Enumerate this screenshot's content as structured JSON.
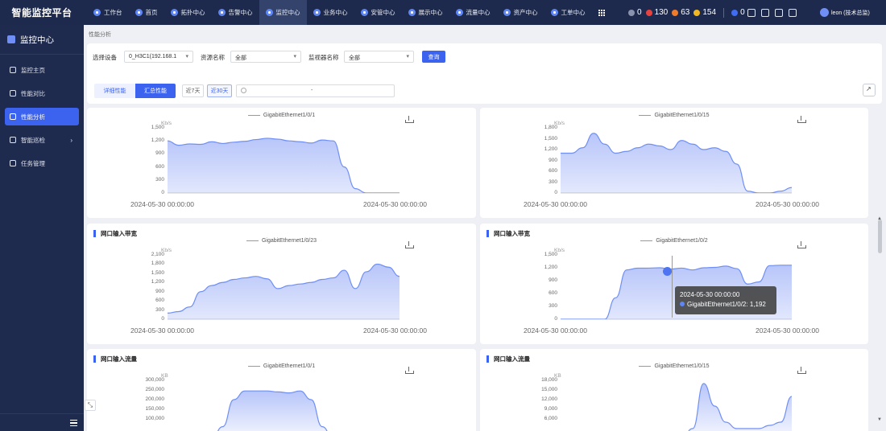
{
  "app": {
    "title": "智能监控平台"
  },
  "nav": [
    {
      "label": "工作台"
    },
    {
      "label": "首页"
    },
    {
      "label": "拓扑中心"
    },
    {
      "label": "告警中心"
    },
    {
      "label": "监控中心"
    },
    {
      "label": "业务中心"
    },
    {
      "label": "安管中心"
    },
    {
      "label": "展示中心"
    },
    {
      "label": "流量中心"
    },
    {
      "label": "资产中心"
    },
    {
      "label": "工单中心"
    }
  ],
  "alarms": [
    {
      "value": "0",
      "color": "#8a93ad"
    },
    {
      "value": "130",
      "color": "#e8423f"
    },
    {
      "value": "63",
      "color": "#f07c2a"
    },
    {
      "value": "154",
      "color": "#f2b823"
    },
    {
      "value": "0",
      "color": "#3f6cf1"
    }
  ],
  "user": {
    "name": "leon (技术总监)"
  },
  "sidebar": {
    "title": "监控中心",
    "items": [
      {
        "label": "监控主页"
      },
      {
        "label": "性能对比"
      },
      {
        "label": "性能分析"
      },
      {
        "label": "智能巡检"
      },
      {
        "label": "任务管理"
      }
    ]
  },
  "breadcrumb": "性能分析",
  "filter": {
    "device_label": "选择设备",
    "device_value": "0_H3C1(192.168.1",
    "resource_label": "资源名称",
    "resource_value": "全部",
    "monitor_label": "监视器名称",
    "monitor_value": "全部",
    "query": "查询",
    "tab_detail": "详细性能",
    "tab_summary": "汇总性能",
    "range7": "近7天",
    "range30": "近30天",
    "date_sep": "-"
  },
  "panels": [
    {
      "title": "",
      "legend": "GigabitEthernet1/0/1",
      "unit": "Kb/s",
      "yticks": [
        "1,500",
        "1,200",
        "900",
        "600",
        "300",
        "0"
      ],
      "xticks": [
        "2024-05-30 00:00:00",
        "2024-05-30 00:00:00"
      ]
    },
    {
      "title": "",
      "legend": "GigabitEthernet1/0/15",
      "unit": "Kb/s",
      "yticks": [
        "1,800",
        "1,500",
        "1,200",
        "900",
        "600",
        "300",
        "0"
      ],
      "xticks": [
        "2024-05-30 00:00:00",
        "2024-05-30 00:00:00"
      ]
    },
    {
      "title": "网口输入带宽",
      "legend": "GigabitEthernet1/0/23",
      "unit": "Kb/s",
      "yticks": [
        "2,100",
        "1,800",
        "1,500",
        "1,200",
        "900",
        "600",
        "300",
        "0"
      ],
      "xticks": [
        "2024-05-30 00:00:00",
        "2024-05-30 00:00:00"
      ]
    },
    {
      "title": "网口输入带宽",
      "legend": "GigabitEthernet1/0/2",
      "unit": "Kb/s",
      "yticks": [
        "1,500",
        "1,200",
        "900",
        "600",
        "300",
        "0"
      ],
      "xticks": [
        "2024-05-30 00:00:00",
        "2024-05-30 00:00:00"
      ]
    },
    {
      "title": "网口输入流量",
      "legend": "GigabitEthernet1/0/1",
      "unit": "KB",
      "yticks": [
        "300,000",
        "250,000",
        "200,000",
        "150,000",
        "100,000"
      ],
      "xticks": []
    },
    {
      "title": "网口输入流量",
      "legend": "GigabitEthernet1/0/15",
      "unit": "KB",
      "yticks": [
        "18,000",
        "15,000",
        "12,000",
        "9,000",
        "6,000"
      ],
      "xticks": []
    }
  ],
  "tooltip": {
    "time": "2024-05-30 00:00:00",
    "series": "GigabitEthernet1/0/2: 1,192"
  },
  "chart_data": [
    {
      "type": "area",
      "series": [
        {
          "name": "GigabitEthernet1/0/1",
          "values": [
            1200,
            1100,
            1130,
            1120,
            1180,
            1140,
            1170,
            1190,
            1230,
            1260,
            1240,
            1200,
            1180,
            1150,
            1220,
            1200,
            600,
            100,
            0,
            0,
            0,
            0
          ]
        }
      ],
      "ylabel": "Kb/s",
      "ylim": [
        0,
        1500
      ]
    },
    {
      "type": "area",
      "series": [
        {
          "name": "GigabitEthernet1/0/15",
          "values": [
            1100,
            1100,
            1250,
            1650,
            1350,
            1100,
            1150,
            1250,
            1350,
            1300,
            1200,
            1450,
            1350,
            1200,
            1250,
            1150,
            800,
            50,
            0,
            0,
            50,
            150
          ]
        }
      ],
      "ylabel": "Kb/s",
      "ylim": [
        0,
        1800
      ]
    },
    {
      "type": "area",
      "series": [
        {
          "name": "GigabitEthernet1/0/23",
          "values": [
            200,
            250,
            400,
            900,
            1100,
            1200,
            1300,
            1350,
            1400,
            1320,
            1000,
            1100,
            1150,
            1200,
            1300,
            1350,
            1600,
            1000,
            1550,
            1800,
            1700,
            1400
          ]
        }
      ],
      "ylabel": "Kb/s",
      "ylim": [
        0,
        2100
      ]
    },
    {
      "type": "area",
      "series": [
        {
          "name": "GigabitEthernet1/0/2",
          "values": [
            0,
            0,
            0,
            0,
            0,
            500,
            1150,
            1190,
            1192,
            1200,
            1170,
            1192,
            1150,
            1200,
            1210,
            1240,
            1180,
            820,
            870,
            1250,
            1260,
            1260
          ]
        }
      ],
      "ylabel": "Kb/s",
      "ylim": [
        0,
        1500
      ]
    },
    {
      "type": "area",
      "series": [
        {
          "name": "GigabitEthernet1/0/1",
          "values": [
            0,
            0,
            0,
            0,
            0,
            60000,
            200000,
            245000,
            245000,
            245000,
            240000,
            235000,
            245000,
            200000,
            60000,
            0,
            0,
            0,
            0,
            0,
            0,
            0
          ]
        }
      ],
      "ylabel": "KB",
      "ylim": [
        100000,
        300000
      ]
    },
    {
      "type": "area",
      "series": [
        {
          "name": "GigabitEthernet1/0/15",
          "values": [
            0,
            0,
            0,
            0,
            0,
            0,
            0,
            0,
            0,
            0,
            0,
            0,
            3000,
            17000,
            10000,
            5000,
            3000,
            3000,
            3000,
            4000,
            5000,
            13000
          ]
        }
      ],
      "ylabel": "KB",
      "ylim": [
        6000,
        18000
      ]
    }
  ]
}
